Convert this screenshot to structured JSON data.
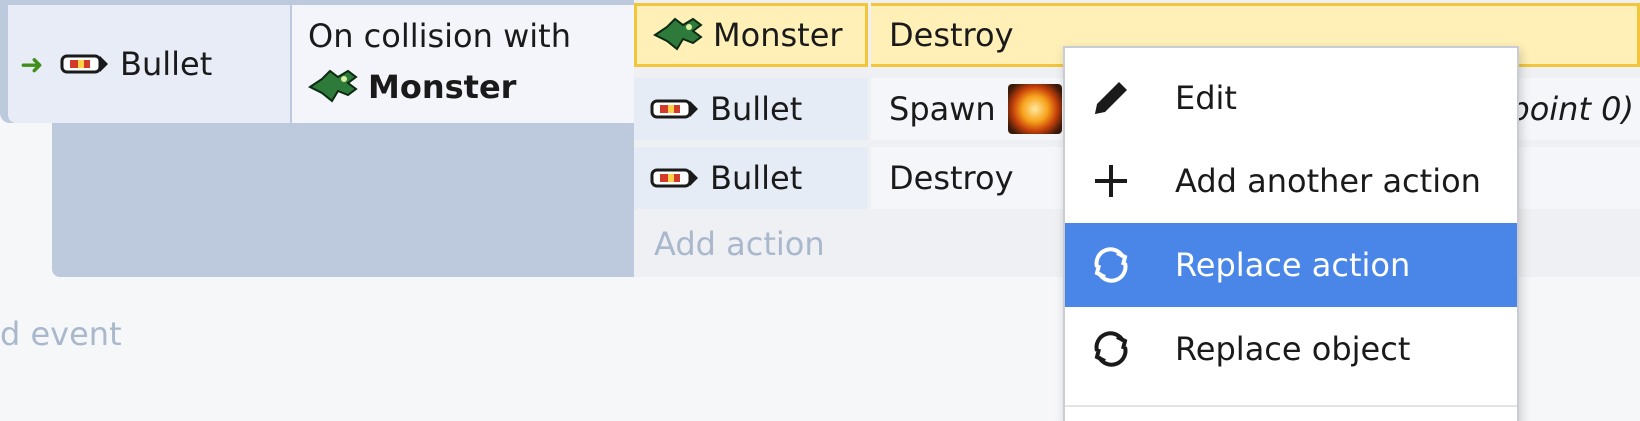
{
  "event": {
    "arrow_icon": "arrow-right-icon",
    "object_name": "Bullet",
    "condition_line1": "On collision with",
    "condition_object": "Monster"
  },
  "actions": [
    {
      "object": "Monster",
      "object_icon": "monster-icon",
      "action": "Destroy",
      "selected": true
    },
    {
      "object": "Bullet",
      "object_icon": "bullet-icon",
      "action": "Spawn",
      "extra": "point 0)"
    },
    {
      "object": "Bullet",
      "object_icon": "bullet-icon",
      "action": "Destroy"
    }
  ],
  "add_action_label": "Add action",
  "add_event_label": "d event",
  "context_menu": {
    "items": [
      {
        "label": "Edit",
        "icon": "pencil-icon"
      },
      {
        "label": "Add another action",
        "icon": "plus-icon"
      },
      {
        "label": "Replace action",
        "icon": "replace-icon",
        "highlighted": true
      },
      {
        "label": "Replace object",
        "icon": "replace-icon"
      }
    ]
  },
  "colors": {
    "highlight": "#4a86e8",
    "selected_row": "#fff0b8",
    "selected_border": "#f2c53b",
    "arrow": "#3f8f1a"
  }
}
